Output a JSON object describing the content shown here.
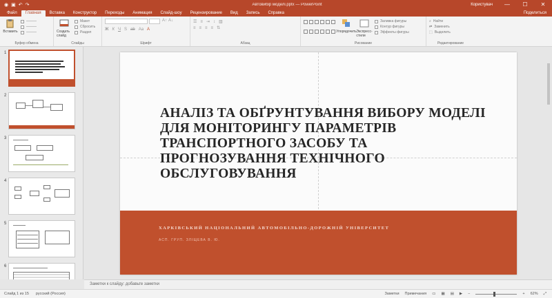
{
  "window": {
    "doc_title": "Автовибір моделі.pptx — PowerPoint",
    "user": "Користувач",
    "minimize": "—",
    "maximize": "☐",
    "close": "✕"
  },
  "tabs": [
    "Файл",
    "Главная",
    "Вставка",
    "Конструктор",
    "Переходы",
    "Анимация",
    "Слайд-шоу",
    "Рецензирование",
    "Вид",
    "Запись",
    "Справка"
  ],
  "active_tab": "Главная",
  "share_label": "Поделиться",
  "ribbon": {
    "clipboard": {
      "paste": "Вставить",
      "label": "Буфер обмена"
    },
    "slides": {
      "new_slide": "Создать слайд",
      "layout": "Макет",
      "reset": "Сбросить",
      "section": "Раздел",
      "label": "Слайды"
    },
    "font": {
      "label": "Шрифт",
      "buttons": [
        "Ж",
        "К",
        "Ч",
        "S",
        "ab",
        "Aa",
        "A"
      ]
    },
    "paragraph": {
      "label": "Абзац"
    },
    "drawing": {
      "label": "Рисование",
      "arrange": "Упорядочить",
      "quick_styles": "Экспресс-стили",
      "fill": "Заливка фигуры",
      "outline": "Контур фигуры",
      "effects": "Эффекты фигуры"
    },
    "editing": {
      "find": "Найти",
      "replace": "Заменить",
      "select": "Выделить",
      "label": "Редактирование"
    }
  },
  "thumbnails": [
    "1",
    "2",
    "3",
    "4",
    "5",
    "6"
  ],
  "slide": {
    "title": "АНАЛІЗ ТА ОБҐРУНТУВАННЯ ВИБОРУ МОДЕЛІ ДЛЯ МОНІТОРИНГУ ПАРАМЕТРІВ ТРАНСПОРТНОГО ЗАСОБУ ТА ПРОГНОЗУВАННЯ ТЕХНІЧНОГО ОБСЛУГОВУВАННЯ",
    "subtitle": "ХАРКІВСЬКИЙ НАЦІОНАЛЬНИЙ АВТОМОБІЛЬНО-ДОРОЖНІЙ УНІВЕРСИТЕТ",
    "author": "АСП. ГРУП. ЗЛІЩЕВА В. Ю."
  },
  "notes_placeholder": "Заметки к слайду: добавьте заметки",
  "status": {
    "slide_info": "Слайд 1 из 15",
    "language": "русский (Россия)",
    "notes": "Заметки",
    "comments": "Примечания",
    "zoom": "62%"
  },
  "colors": {
    "accent": "#b7472a",
    "band": "#c0502d"
  }
}
